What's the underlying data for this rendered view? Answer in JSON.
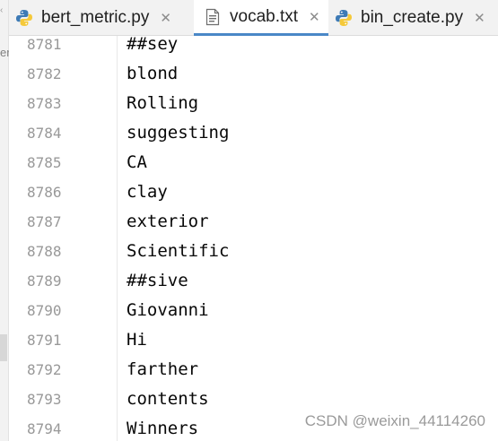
{
  "tabs": [
    {
      "label": "bert_metric.py",
      "icon": "python-file-icon",
      "active": false
    },
    {
      "label": "vocab.txt",
      "icon": "text-file-icon",
      "active": true
    },
    {
      "label": "bin_create.py",
      "icon": "python-file-icon",
      "active": false
    }
  ],
  "close_glyph": "✕",
  "left_strip": {
    "char": "er"
  },
  "lines": [
    {
      "number": "8781",
      "text": "##sey"
    },
    {
      "number": "8782",
      "text": "blond"
    },
    {
      "number": "8783",
      "text": "Rolling"
    },
    {
      "number": "8784",
      "text": "suggesting"
    },
    {
      "number": "8785",
      "text": "CA"
    },
    {
      "number": "8786",
      "text": "clay"
    },
    {
      "number": "8787",
      "text": "exterior"
    },
    {
      "number": "8788",
      "text": "Scientific"
    },
    {
      "number": "8789",
      "text": "##sive"
    },
    {
      "number": "8790",
      "text": "Giovanni"
    },
    {
      "number": "8791",
      "text": "Hi"
    },
    {
      "number": "8792",
      "text": "farther"
    },
    {
      "number": "8793",
      "text": "contents"
    },
    {
      "number": "8794",
      "text": "Winners"
    }
  ],
  "watermark": "CSDN @weixin_44114260",
  "colors": {
    "python_blue": "#3d7ab5",
    "python_yellow": "#f5c93a",
    "tab_active_underline": "#4a88c7"
  }
}
